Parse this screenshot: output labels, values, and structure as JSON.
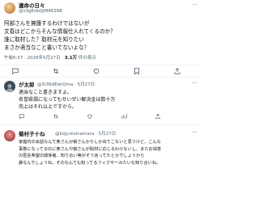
{
  "main_post": {
    "name": "違命の日々",
    "handle": "@s3gEobQjM46398",
    "body_lines": [
      "阿部さんを擁護するわけではないが",
      "文春はどこからそんな情報仕入れてくるのか？",
      "誰に取材した？取材元を知りたい",
      "まさか適当なこと書いてないよな？"
    ],
    "timestamp": "午後6:57 · 2026年5月27日 · ",
    "views_count": "3.1万",
    "views_label": " 件の表示"
  },
  "replies": [
    {
      "name": "が太郎",
      "handle": "@Xi36dEekQma · 5月27日",
      "body_lines": [
        "適当なこと書きますよ。",
        "名誉毀損になってもせいぜい解決金は数十万",
        "売上はそれ以上ですから。"
      ]
    },
    {
      "name": "菊村子十ね",
      "handle": "@kojyutoinamara · 5月27日",
      "body_lines": [
        "家庭内の会話なんて奥さんか娘さんからしか出てこないと思うけど、こんな",
        "事態になってるのに奥さんや娘さんが取材に応じるわけないし、またお得意",
        "の匿名希望の関係者、知り合い等がそう言ってたとかでしょうから",
        "誰なんでしょうね。そのなんても知ってるフィクサーみたいな知り合いね。"
      ]
    }
  ],
  "colors": {
    "text": "#0f1419",
    "secondary": "#536471",
    "divider": "#eff3f4",
    "icon": "#536471"
  }
}
